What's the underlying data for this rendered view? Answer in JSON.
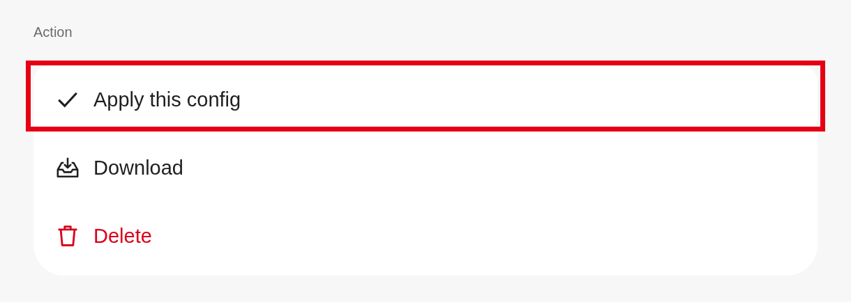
{
  "section_label": "Action",
  "items": [
    {
      "kind": "check",
      "label": "Apply this config",
      "highlighted": true,
      "danger": false
    },
    {
      "kind": "download",
      "label": "Download",
      "highlighted": false,
      "danger": false
    },
    {
      "kind": "trash",
      "label": "Delete",
      "highlighted": false,
      "danger": true
    }
  ]
}
